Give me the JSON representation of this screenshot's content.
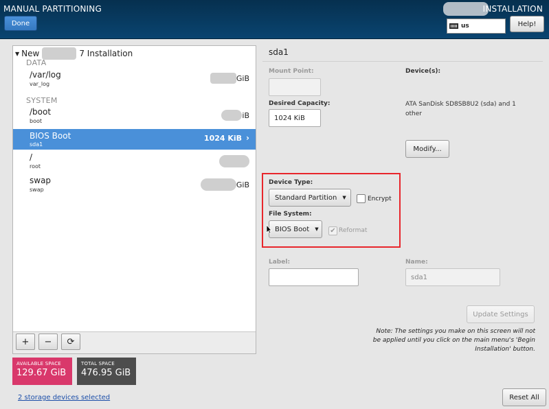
{
  "header": {
    "title": "MANUAL PARTITIONING",
    "right_title": "INSTALLATION",
    "done_label": "Done",
    "keyboard_layout": "us",
    "help_label": "Help!"
  },
  "tree": {
    "root_prefix": "New",
    "root_suffix": "7 Installation",
    "sections": [
      {
        "label": "DATA"
      },
      {
        "label": "SYSTEM"
      }
    ],
    "rows": [
      {
        "name": "/var/log",
        "sub": "var_log",
        "size_suffix": "GiB",
        "selected": false
      },
      {
        "name": "/boot",
        "sub": "boot",
        "size_suffix": "iB",
        "selected": false
      },
      {
        "name": "BIOS Boot",
        "sub": "sda1",
        "size": "1024 KiB",
        "selected": true
      },
      {
        "name": "/",
        "sub": "root",
        "size_suffix": "",
        "selected": false
      },
      {
        "name": "swap",
        "sub": "swap",
        "size_suffix": "GiB",
        "selected": false
      }
    ],
    "buttons": {
      "add": "+",
      "remove": "−",
      "refresh": "⟳"
    }
  },
  "space": {
    "available_label": "AVAILABLE SPACE",
    "available_value": "129.67 GiB",
    "total_label": "TOTAL SPACE",
    "total_value": "476.95 GiB"
  },
  "storage_link": "2 storage devices selected",
  "details": {
    "partition_name": "sda1",
    "mount_point_label": "Mount Point:",
    "mount_point_value": "",
    "desired_capacity_label": "Desired Capacity:",
    "desired_capacity_value": "1024 KiB",
    "devices_label": "Device(s):",
    "devices_text": "ATA SanDisk SD8SB8U2 (sda) and 1 other",
    "modify_label": "Modify...",
    "device_type_label": "Device Type:",
    "device_type_value": "Standard Partition",
    "encrypt_label": "Encrypt",
    "encrypt_checked": false,
    "file_system_label": "File System:",
    "file_system_value": "BIOS Boot",
    "reformat_label": "Reformat",
    "reformat_checked": true,
    "label_label": "Label:",
    "label_value": "",
    "name_label": "Name:",
    "name_value": "sda1",
    "update_label": "Update Settings",
    "note": "Note:  The settings you make on this screen will not be applied until you click on the main menu's 'Begin Installation' button.",
    "reset_label": "Reset All"
  },
  "colors": {
    "header": "#0a4470",
    "selection": "#4a90d9",
    "available_space": "#d9386b",
    "total_space": "#4d4d4d",
    "highlight_box": "#e8252b"
  }
}
